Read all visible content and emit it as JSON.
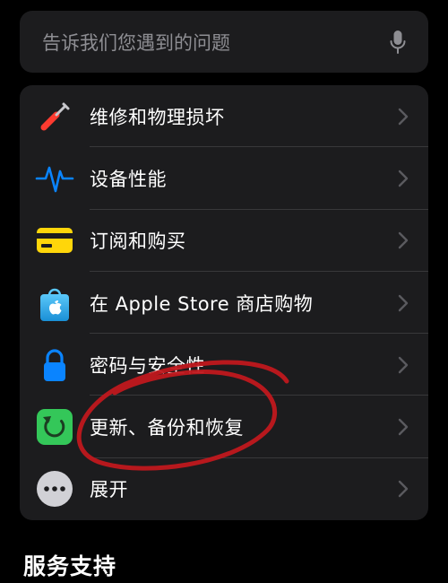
{
  "search": {
    "placeholder": "告诉我们您遇到的问题",
    "icon": "microphone-icon"
  },
  "topics": [
    {
      "label": "维修和物理损坏",
      "icon": "screwdriver-icon",
      "color": "#ff3b30"
    },
    {
      "label": "设备性能",
      "icon": "waveform-icon",
      "color": "#0a84ff"
    },
    {
      "label": "订阅和购买",
      "icon": "credit-card-icon",
      "color": "#ffd60a"
    },
    {
      "label": "在 Apple Store 商店购物",
      "icon": "shopping-bag-icon",
      "color": "#32ade6"
    },
    {
      "label": "密码与安全性",
      "icon": "lock-icon",
      "color": "#0a84ff"
    },
    {
      "label": "更新、备份和恢复",
      "icon": "restore-icon",
      "color": "#34c759"
    },
    {
      "label": "展开",
      "icon": "more-icon",
      "color": "#d1d1d6"
    }
  ],
  "section": {
    "title": "服务支持"
  },
  "annotation_color": "#c0181e"
}
